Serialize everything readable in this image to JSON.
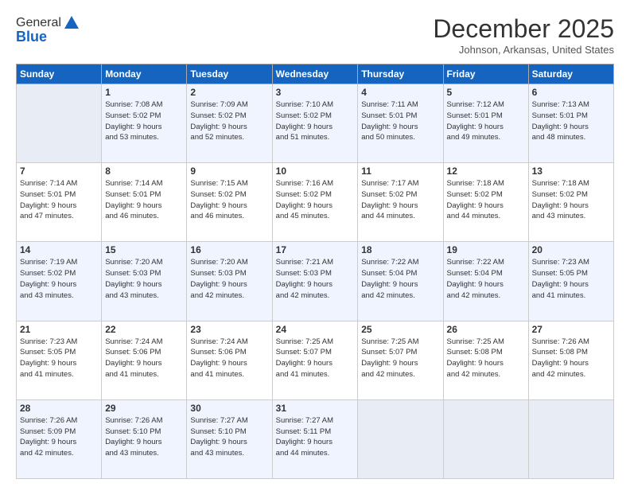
{
  "logo": {
    "general": "General",
    "blue": "Blue"
  },
  "header": {
    "month": "December 2025",
    "location": "Johnson, Arkansas, United States"
  },
  "weekdays": [
    "Sunday",
    "Monday",
    "Tuesday",
    "Wednesday",
    "Thursday",
    "Friday",
    "Saturday"
  ],
  "weeks": [
    [
      {
        "day": "",
        "info": ""
      },
      {
        "day": "1",
        "info": "Sunrise: 7:08 AM\nSunset: 5:02 PM\nDaylight: 9 hours\nand 53 minutes."
      },
      {
        "day": "2",
        "info": "Sunrise: 7:09 AM\nSunset: 5:02 PM\nDaylight: 9 hours\nand 52 minutes."
      },
      {
        "day": "3",
        "info": "Sunrise: 7:10 AM\nSunset: 5:02 PM\nDaylight: 9 hours\nand 51 minutes."
      },
      {
        "day": "4",
        "info": "Sunrise: 7:11 AM\nSunset: 5:01 PM\nDaylight: 9 hours\nand 50 minutes."
      },
      {
        "day": "5",
        "info": "Sunrise: 7:12 AM\nSunset: 5:01 PM\nDaylight: 9 hours\nand 49 minutes."
      },
      {
        "day": "6",
        "info": "Sunrise: 7:13 AM\nSunset: 5:01 PM\nDaylight: 9 hours\nand 48 minutes."
      }
    ],
    [
      {
        "day": "7",
        "info": "Sunrise: 7:14 AM\nSunset: 5:01 PM\nDaylight: 9 hours\nand 47 minutes."
      },
      {
        "day": "8",
        "info": "Sunrise: 7:14 AM\nSunset: 5:01 PM\nDaylight: 9 hours\nand 46 minutes."
      },
      {
        "day": "9",
        "info": "Sunrise: 7:15 AM\nSunset: 5:02 PM\nDaylight: 9 hours\nand 46 minutes."
      },
      {
        "day": "10",
        "info": "Sunrise: 7:16 AM\nSunset: 5:02 PM\nDaylight: 9 hours\nand 45 minutes."
      },
      {
        "day": "11",
        "info": "Sunrise: 7:17 AM\nSunset: 5:02 PM\nDaylight: 9 hours\nand 44 minutes."
      },
      {
        "day": "12",
        "info": "Sunrise: 7:18 AM\nSunset: 5:02 PM\nDaylight: 9 hours\nand 44 minutes."
      },
      {
        "day": "13",
        "info": "Sunrise: 7:18 AM\nSunset: 5:02 PM\nDaylight: 9 hours\nand 43 minutes."
      }
    ],
    [
      {
        "day": "14",
        "info": "Sunrise: 7:19 AM\nSunset: 5:02 PM\nDaylight: 9 hours\nand 43 minutes."
      },
      {
        "day": "15",
        "info": "Sunrise: 7:20 AM\nSunset: 5:03 PM\nDaylight: 9 hours\nand 43 minutes."
      },
      {
        "day": "16",
        "info": "Sunrise: 7:20 AM\nSunset: 5:03 PM\nDaylight: 9 hours\nand 42 minutes."
      },
      {
        "day": "17",
        "info": "Sunrise: 7:21 AM\nSunset: 5:03 PM\nDaylight: 9 hours\nand 42 minutes."
      },
      {
        "day": "18",
        "info": "Sunrise: 7:22 AM\nSunset: 5:04 PM\nDaylight: 9 hours\nand 42 minutes."
      },
      {
        "day": "19",
        "info": "Sunrise: 7:22 AM\nSunset: 5:04 PM\nDaylight: 9 hours\nand 42 minutes."
      },
      {
        "day": "20",
        "info": "Sunrise: 7:23 AM\nSunset: 5:05 PM\nDaylight: 9 hours\nand 41 minutes."
      }
    ],
    [
      {
        "day": "21",
        "info": "Sunrise: 7:23 AM\nSunset: 5:05 PM\nDaylight: 9 hours\nand 41 minutes."
      },
      {
        "day": "22",
        "info": "Sunrise: 7:24 AM\nSunset: 5:06 PM\nDaylight: 9 hours\nand 41 minutes."
      },
      {
        "day": "23",
        "info": "Sunrise: 7:24 AM\nSunset: 5:06 PM\nDaylight: 9 hours\nand 41 minutes."
      },
      {
        "day": "24",
        "info": "Sunrise: 7:25 AM\nSunset: 5:07 PM\nDaylight: 9 hours\nand 41 minutes."
      },
      {
        "day": "25",
        "info": "Sunrise: 7:25 AM\nSunset: 5:07 PM\nDaylight: 9 hours\nand 42 minutes."
      },
      {
        "day": "26",
        "info": "Sunrise: 7:25 AM\nSunset: 5:08 PM\nDaylight: 9 hours\nand 42 minutes."
      },
      {
        "day": "27",
        "info": "Sunrise: 7:26 AM\nSunset: 5:08 PM\nDaylight: 9 hours\nand 42 minutes."
      }
    ],
    [
      {
        "day": "28",
        "info": "Sunrise: 7:26 AM\nSunset: 5:09 PM\nDaylight: 9 hours\nand 42 minutes."
      },
      {
        "day": "29",
        "info": "Sunrise: 7:26 AM\nSunset: 5:10 PM\nDaylight: 9 hours\nand 43 minutes."
      },
      {
        "day": "30",
        "info": "Sunrise: 7:27 AM\nSunset: 5:10 PM\nDaylight: 9 hours\nand 43 minutes."
      },
      {
        "day": "31",
        "info": "Sunrise: 7:27 AM\nSunset: 5:11 PM\nDaylight: 9 hours\nand 44 minutes."
      },
      {
        "day": "",
        "info": ""
      },
      {
        "day": "",
        "info": ""
      },
      {
        "day": "",
        "info": ""
      }
    ]
  ]
}
